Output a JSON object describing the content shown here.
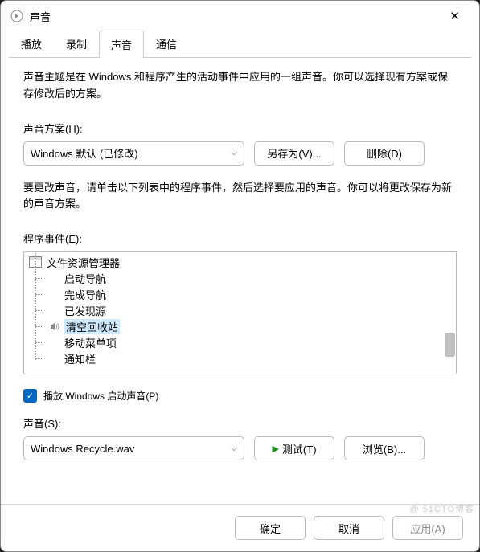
{
  "window": {
    "title": "声音"
  },
  "tabs": {
    "items": [
      {
        "label": "播放"
      },
      {
        "label": "录制"
      },
      {
        "label": "声音"
      },
      {
        "label": "通信"
      }
    ],
    "active": 2
  },
  "description": "声音主题是在 Windows 和程序产生的活动事件中应用的一组声音。你可以选择现有方案或保存修改后的方案。",
  "scheme": {
    "label": "声音方案(H):",
    "selected": "Windows 默认 (已修改)",
    "save_as": "另存为(V)...",
    "delete": "删除(D)"
  },
  "events": {
    "description": "要更改声音，请单击以下列表中的程序事件，然后选择要应用的声音。你可以将更改保存为新的声音方案。",
    "label": "程序事件(E):",
    "root": "文件资源管理器",
    "items": [
      {
        "label": "启动导航",
        "has_sound": false
      },
      {
        "label": "完成导航",
        "has_sound": false
      },
      {
        "label": "已发现源",
        "has_sound": false
      },
      {
        "label": "清空回收站",
        "has_sound": true,
        "selected": true
      },
      {
        "label": "移动菜单项",
        "has_sound": false
      },
      {
        "label": "通知栏",
        "has_sound": false
      }
    ]
  },
  "startup": {
    "label": "播放 Windows 启动声音(P)",
    "checked": true
  },
  "sound": {
    "label": "声音(S):",
    "selected": "Windows Recycle.wav",
    "test": "测试(T)",
    "browse": "浏览(B)..."
  },
  "footer": {
    "ok": "确定",
    "cancel": "取消",
    "apply": "应用(A)"
  },
  "watermark": "@ 51CTO博客"
}
